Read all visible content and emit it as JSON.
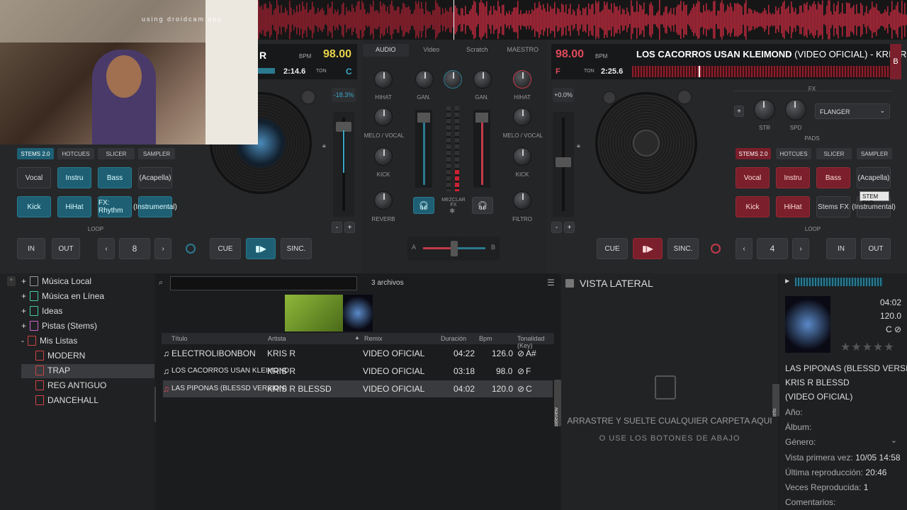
{
  "webcam_text": "using droidcam.app",
  "left_deck": {
    "title_initial": "R",
    "bpm_label": "BPM",
    "bpm": "98.00",
    "time": "2:14.6",
    "ton_label": "TON",
    "key": "C",
    "pitch": "-18.3%",
    "tabs": [
      "STEMS 2.0",
      "HOTCUES",
      "SLICER",
      "SAMPLER"
    ],
    "pads_row1": [
      "Vocal",
      "Instru",
      "Bass",
      "(Acapella)"
    ],
    "pads_row2": [
      "Kick",
      "HiHat",
      "FX: Rhythm",
      "(Instrumental)"
    ],
    "loop_label": "LOOP",
    "in": "IN",
    "out": "OUT",
    "loop_size": "8",
    "cue": "CUE",
    "sync": "SINC."
  },
  "mixer": {
    "tabs": [
      "AUDIO",
      "Video",
      "Scratch",
      "MAESTRO"
    ],
    "gain": "GAN.",
    "left_eq": [
      "HIHAT",
      "MELO / VOCAL",
      "KICK",
      "REVERB"
    ],
    "right_eq": [
      "HIHAT",
      "MELO / VOCAL",
      "KICK",
      "FILTRO"
    ],
    "mix_fx": "MEZCLAR FX",
    "a": "A",
    "b": "B"
  },
  "right_deck": {
    "bpm": "98.00",
    "bpm_label": "BPM",
    "title": "LOS CACORROS USAN KLEIMOND",
    "title_rest": " (VIDEO OFICIAL) - KRIS R",
    "flag": "F",
    "ton_label": "TON",
    "time": "2:25.6",
    "side": "B",
    "pitch": "+0.0%",
    "fx_label": "FX",
    "str": "STR",
    "spd": "SPD",
    "fx_effect": "FLANGER",
    "pads_label": "PADS",
    "tabs": [
      "STEMS 2.0",
      "HOTCUES",
      "SLICER",
      "SAMPLER"
    ],
    "pads_row1": [
      "Vocal",
      "Instru",
      "Bass",
      "(Acapella)"
    ],
    "pads_row2": [
      "Kick",
      "HiHat",
      "Stems FX",
      "(Instrumental)"
    ],
    "tooltip": "STEM PAD",
    "loop_label": "LOOP",
    "in": "IN",
    "out": "OUT",
    "loop_size": "4",
    "cue": "CUE",
    "sync": "SINC."
  },
  "tree": [
    "Música Local",
    "Música en Línea",
    "Ideas",
    "Pistas (Stems)",
    "Mis Listas",
    "MODERN",
    "TRAP",
    "REG ANTIGUO",
    "DANCEHALL"
  ],
  "browser": {
    "file_count": "3 archivos",
    "folders_tab": "folders",
    "sideview_tab": "sideview",
    "info_tab": "info",
    "columns": [
      "Título",
      "Artista",
      "Remix",
      "Duración",
      "Bpm",
      "Tonalidad (Key)"
    ],
    "tracks": [
      {
        "title": "ELECTROLIBONBON",
        "artist": "KRIS R",
        "remix": "VIDEO OFICIAL",
        "dur": "04:22",
        "bpm": "126.0",
        "key": "A#"
      },
      {
        "title": "LOS CACORROS USAN KLEIMOND",
        "artist": "KRIS R",
        "remix": "VIDEO OFICIAL",
        "dur": "03:18",
        "bpm": "98.0",
        "key": "F"
      },
      {
        "title": "LAS PIPONAS (BLESSD VERSION)",
        "artist": "KRIS R  BLESSD",
        "remix": "VIDEO OFICIAL",
        "dur": "04:02",
        "bpm": "120.0",
        "key": "C"
      }
    ]
  },
  "sideview": {
    "title": "VISTA LATERAL",
    "line1": "ARRASTRE Y SUELTE CUALQUIER CARPETA AQUI",
    "line2": "O USE LOS BOTONES DE ABAJO"
  },
  "info": {
    "dur": "04:02",
    "bpm": "120.0",
    "key": "C",
    "title": "LAS PIPONAS (BLESSD VERSION)",
    "artist": "KRIS R  BLESSD",
    "remix": "(VIDEO OFICIAL)",
    "year": "Año:",
    "album": "Álbum:",
    "genre": "Género:",
    "first_seen": "Vista primera vez:",
    "first_seen_val": "10/05 14:58",
    "last_play": "Última reproducción:",
    "last_play_val": "20:46",
    "plays": "Veces Reproducida:",
    "plays_val": "1",
    "comments": "Comentarios:"
  },
  "colors": {
    "accent_left": "#1e5f74",
    "accent_right": "#7a1f2b",
    "bpm_yellow": "#e8d34a"
  }
}
